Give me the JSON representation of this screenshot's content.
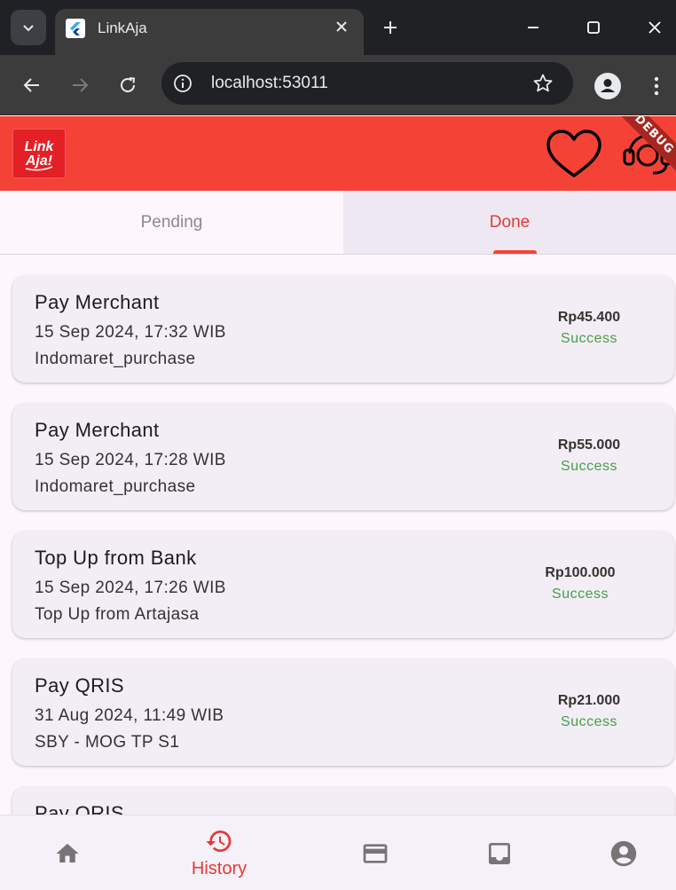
{
  "browser": {
    "tab_title": "LinkAja",
    "url": "localhost:53011"
  },
  "appbar": {
    "logo_text": "LinkAja!",
    "debug_label": "DEBUG",
    "brand_color": "#f44336"
  },
  "tabs": [
    {
      "label": "Pending",
      "active": false
    },
    {
      "label": "Done",
      "active": true
    }
  ],
  "transactions": [
    {
      "title": "Pay Merchant",
      "date": "15 Sep 2024, 17:32 WIB",
      "description": "Indomaret_purchase",
      "amount": "Rp45.400",
      "status": "Success"
    },
    {
      "title": "Pay Merchant",
      "date": "15 Sep 2024, 17:28 WIB",
      "description": "Indomaret_purchase",
      "amount": "Rp55.000",
      "status": "Success"
    },
    {
      "title": "Top Up from Bank",
      "date": "15 Sep 2024, 17:26 WIB",
      "description": "Top Up from Artajasa",
      "amount": "Rp100.000",
      "status": "Success"
    },
    {
      "title": "Pay QRIS",
      "date": "31 Aug 2024, 11:49 WIB",
      "description": "SBY - MOG TP S1",
      "amount": "Rp21.000",
      "status": "Success"
    },
    {
      "title": "Pay QRIS",
      "date": "",
      "description": "",
      "amount": "",
      "status": ""
    }
  ],
  "bottom_nav": [
    {
      "icon": "home-icon",
      "label": "",
      "active": false
    },
    {
      "icon": "history-icon",
      "label": "History",
      "active": true
    },
    {
      "icon": "card-icon",
      "label": "",
      "active": false
    },
    {
      "icon": "inbox-icon",
      "label": "",
      "active": false
    },
    {
      "icon": "account-icon",
      "label": "",
      "active": false
    }
  ],
  "colors": {
    "accent": "#e53935",
    "success": "#43a047"
  }
}
